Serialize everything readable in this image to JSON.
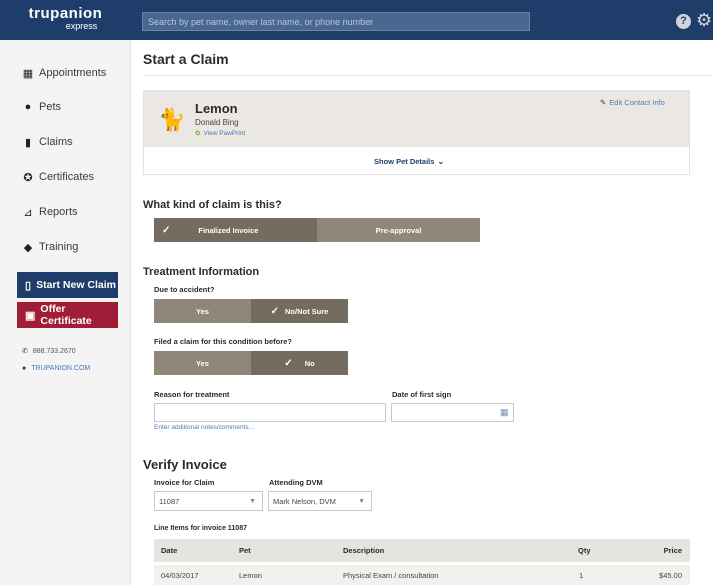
{
  "header": {
    "brand": "trupanion",
    "brand_sub": "express",
    "search_placeholder": "Search by pet name, owner last name, or phone number",
    "help_glyph": "?",
    "accent": "#1f3d6b"
  },
  "sidebar": {
    "items": [
      {
        "label": "Appointments",
        "icon": "calendar-icon"
      },
      {
        "label": "Pets",
        "icon": "paw-icon"
      },
      {
        "label": "Claims",
        "icon": "clipboard-icon"
      },
      {
        "label": "Certificates",
        "icon": "ribbon-icon"
      },
      {
        "label": "Reports",
        "icon": "chart-icon"
      },
      {
        "label": "Training",
        "icon": "graduation-cap-icon"
      }
    ],
    "start_claim": "Start New Claim",
    "offer_certificate": "Offer Certificate",
    "phone": "888.733.2670",
    "website": "TRUPANION.COM"
  },
  "main": {
    "title": "Start a Claim",
    "pet": {
      "name": "Lemon",
      "owner": "Donald Bing",
      "pawprint_link": "View PawPrint",
      "edit_contact": "Edit Contact Info",
      "show_details": "Show Pet Details"
    },
    "claim_kind": {
      "question": "What kind of claim is this?",
      "options": [
        "Finalized Invoice",
        "Pre-approval"
      ],
      "selected": "Finalized Invoice"
    },
    "treatment": {
      "title": "Treatment Information",
      "accident_label": "Due to accident?",
      "accident_options": [
        "Yes",
        "No/Not Sure"
      ],
      "accident_selected": "No/Not Sure",
      "filed_label": "Filed a claim for this condition before?",
      "filed_options": [
        "Yes",
        "No"
      ],
      "filed_selected": "No",
      "reason_label": "Reason for treatment",
      "reason_value": "",
      "first_sign_label": "Date of first sign",
      "first_sign_value": "",
      "notes_link": "Enter additional notes/comments..."
    },
    "invoice": {
      "title": "Verify Invoice",
      "invoice_label": "Invoice for Claim",
      "invoice_value": "11087",
      "dvm_label": "Attending DVM",
      "dvm_value": "Mark Nelson, DVM",
      "line_items_label": "Line Items for invoice 11087",
      "columns": [
        "Date",
        "Pet",
        "Description",
        "Qty",
        "Price"
      ],
      "rows": [
        {
          "date": "04/03/2017",
          "pet": "Lemon",
          "description": "Physical Exam / consultation",
          "qty": "1",
          "price": "$45.00"
        }
      ]
    }
  }
}
